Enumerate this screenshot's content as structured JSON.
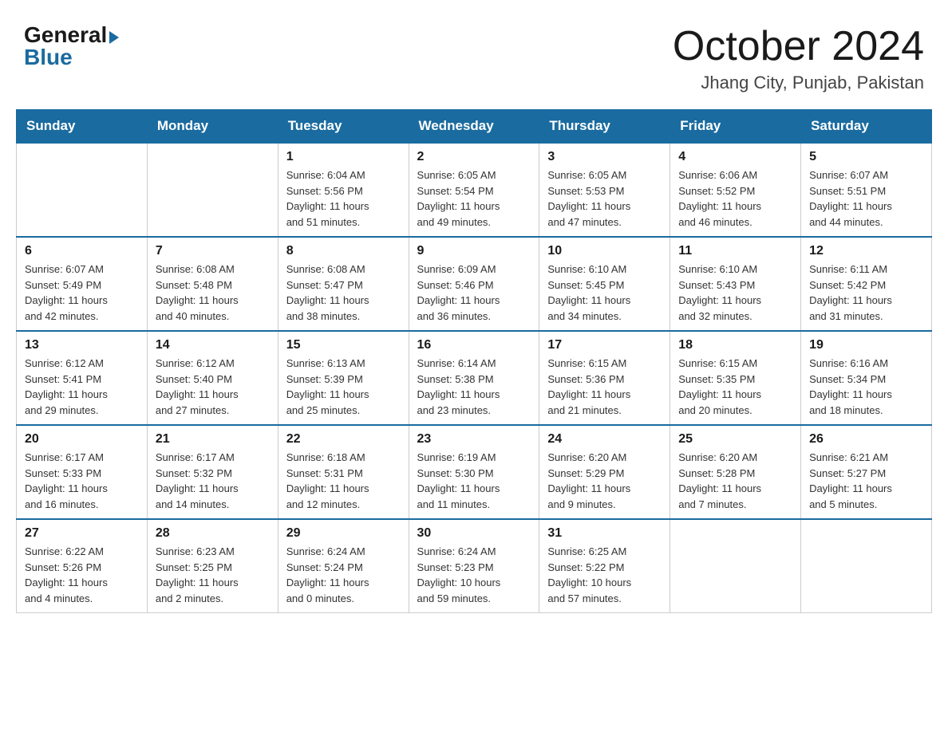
{
  "header": {
    "logo_general": "General",
    "logo_blue": "Blue",
    "month_title": "October 2024",
    "location": "Jhang City, Punjab, Pakistan"
  },
  "days_of_week": [
    "Sunday",
    "Monday",
    "Tuesday",
    "Wednesday",
    "Thursday",
    "Friday",
    "Saturday"
  ],
  "weeks": [
    [
      {
        "day": "",
        "info": ""
      },
      {
        "day": "",
        "info": ""
      },
      {
        "day": "1",
        "info": "Sunrise: 6:04 AM\nSunset: 5:56 PM\nDaylight: 11 hours\nand 51 minutes."
      },
      {
        "day": "2",
        "info": "Sunrise: 6:05 AM\nSunset: 5:54 PM\nDaylight: 11 hours\nand 49 minutes."
      },
      {
        "day": "3",
        "info": "Sunrise: 6:05 AM\nSunset: 5:53 PM\nDaylight: 11 hours\nand 47 minutes."
      },
      {
        "day": "4",
        "info": "Sunrise: 6:06 AM\nSunset: 5:52 PM\nDaylight: 11 hours\nand 46 minutes."
      },
      {
        "day": "5",
        "info": "Sunrise: 6:07 AM\nSunset: 5:51 PM\nDaylight: 11 hours\nand 44 minutes."
      }
    ],
    [
      {
        "day": "6",
        "info": "Sunrise: 6:07 AM\nSunset: 5:49 PM\nDaylight: 11 hours\nand 42 minutes."
      },
      {
        "day": "7",
        "info": "Sunrise: 6:08 AM\nSunset: 5:48 PM\nDaylight: 11 hours\nand 40 minutes."
      },
      {
        "day": "8",
        "info": "Sunrise: 6:08 AM\nSunset: 5:47 PM\nDaylight: 11 hours\nand 38 minutes."
      },
      {
        "day": "9",
        "info": "Sunrise: 6:09 AM\nSunset: 5:46 PM\nDaylight: 11 hours\nand 36 minutes."
      },
      {
        "day": "10",
        "info": "Sunrise: 6:10 AM\nSunset: 5:45 PM\nDaylight: 11 hours\nand 34 minutes."
      },
      {
        "day": "11",
        "info": "Sunrise: 6:10 AM\nSunset: 5:43 PM\nDaylight: 11 hours\nand 32 minutes."
      },
      {
        "day": "12",
        "info": "Sunrise: 6:11 AM\nSunset: 5:42 PM\nDaylight: 11 hours\nand 31 minutes."
      }
    ],
    [
      {
        "day": "13",
        "info": "Sunrise: 6:12 AM\nSunset: 5:41 PM\nDaylight: 11 hours\nand 29 minutes."
      },
      {
        "day": "14",
        "info": "Sunrise: 6:12 AM\nSunset: 5:40 PM\nDaylight: 11 hours\nand 27 minutes."
      },
      {
        "day": "15",
        "info": "Sunrise: 6:13 AM\nSunset: 5:39 PM\nDaylight: 11 hours\nand 25 minutes."
      },
      {
        "day": "16",
        "info": "Sunrise: 6:14 AM\nSunset: 5:38 PM\nDaylight: 11 hours\nand 23 minutes."
      },
      {
        "day": "17",
        "info": "Sunrise: 6:15 AM\nSunset: 5:36 PM\nDaylight: 11 hours\nand 21 minutes."
      },
      {
        "day": "18",
        "info": "Sunrise: 6:15 AM\nSunset: 5:35 PM\nDaylight: 11 hours\nand 20 minutes."
      },
      {
        "day": "19",
        "info": "Sunrise: 6:16 AM\nSunset: 5:34 PM\nDaylight: 11 hours\nand 18 minutes."
      }
    ],
    [
      {
        "day": "20",
        "info": "Sunrise: 6:17 AM\nSunset: 5:33 PM\nDaylight: 11 hours\nand 16 minutes."
      },
      {
        "day": "21",
        "info": "Sunrise: 6:17 AM\nSunset: 5:32 PM\nDaylight: 11 hours\nand 14 minutes."
      },
      {
        "day": "22",
        "info": "Sunrise: 6:18 AM\nSunset: 5:31 PM\nDaylight: 11 hours\nand 12 minutes."
      },
      {
        "day": "23",
        "info": "Sunrise: 6:19 AM\nSunset: 5:30 PM\nDaylight: 11 hours\nand 11 minutes."
      },
      {
        "day": "24",
        "info": "Sunrise: 6:20 AM\nSunset: 5:29 PM\nDaylight: 11 hours\nand 9 minutes."
      },
      {
        "day": "25",
        "info": "Sunrise: 6:20 AM\nSunset: 5:28 PM\nDaylight: 11 hours\nand 7 minutes."
      },
      {
        "day": "26",
        "info": "Sunrise: 6:21 AM\nSunset: 5:27 PM\nDaylight: 11 hours\nand 5 minutes."
      }
    ],
    [
      {
        "day": "27",
        "info": "Sunrise: 6:22 AM\nSunset: 5:26 PM\nDaylight: 11 hours\nand 4 minutes."
      },
      {
        "day": "28",
        "info": "Sunrise: 6:23 AM\nSunset: 5:25 PM\nDaylight: 11 hours\nand 2 minutes."
      },
      {
        "day": "29",
        "info": "Sunrise: 6:24 AM\nSunset: 5:24 PM\nDaylight: 11 hours\nand 0 minutes."
      },
      {
        "day": "30",
        "info": "Sunrise: 6:24 AM\nSunset: 5:23 PM\nDaylight: 10 hours\nand 59 minutes."
      },
      {
        "day": "31",
        "info": "Sunrise: 6:25 AM\nSunset: 5:22 PM\nDaylight: 10 hours\nand 57 minutes."
      },
      {
        "day": "",
        "info": ""
      },
      {
        "day": "",
        "info": ""
      }
    ]
  ]
}
